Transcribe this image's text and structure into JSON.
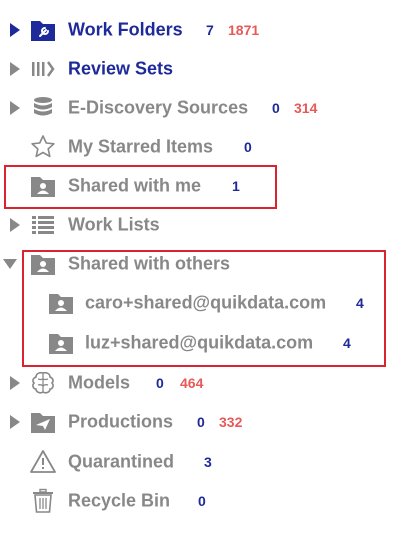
{
  "tree": {
    "work_folders": {
      "label": "Work Folders",
      "count": "7",
      "count2": "1871"
    },
    "review_sets": {
      "label": "Review Sets"
    },
    "ediscovery": {
      "label": "E-Discovery Sources",
      "count": "0",
      "count2": "314"
    },
    "starred": {
      "label": "My Starred Items",
      "count": "0"
    },
    "shared_with_me": {
      "label": "Shared with me",
      "count": "1"
    },
    "work_lists": {
      "label": "Work Lists"
    },
    "shared_with_others": {
      "label": "Shared with others",
      "children": [
        {
          "label": "caro+shared@quikdata.com",
          "count": "4"
        },
        {
          "label": "luz+shared@quikdata.com",
          "count": "4"
        }
      ]
    },
    "models": {
      "label": "Models",
      "count": "0",
      "count2": "464"
    },
    "productions": {
      "label": "Productions",
      "count": "0",
      "count2": "332"
    },
    "quarantined": {
      "label": "Quarantined",
      "count": "3"
    },
    "recycle_bin": {
      "label": "Recycle Bin",
      "count": "0"
    }
  },
  "colors": {
    "accent": "#1f2a9a",
    "muted": "#888888",
    "alert": "#e8595a",
    "highlight": "#d9232e"
  },
  "icons": [
    "folder-wrench-icon",
    "library-icon",
    "database-icon",
    "star-icon",
    "shared-folder-icon",
    "list-icon",
    "shared-folder-icon",
    "brain-icon",
    "send-folder-icon",
    "warning-icon",
    "trash-icon"
  ]
}
